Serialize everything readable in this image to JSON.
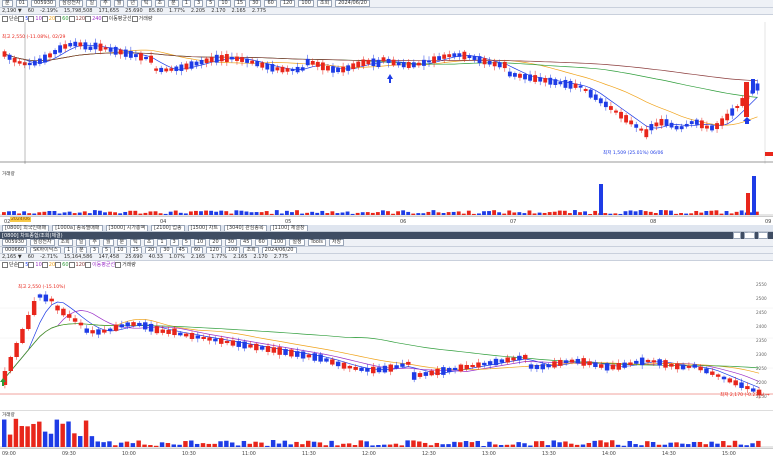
{
  "top": {
    "toolbar1_items": [
      "분",
      "01",
      "005930",
      "삼성전자",
      "일",
      "주",
      "월",
      "년",
      "틱",
      "초",
      "분",
      "1",
      "3",
      "5",
      "10",
      "15",
      "30",
      "60",
      "120",
      "100",
      "조회",
      "2024/06/20"
    ],
    "toolbar2_items": [
      "2,190 ▼",
      "60",
      "-2.19%",
      "15,798,508",
      "171,655",
      "25.690",
      "85.80",
      "1.77%",
      "2.205",
      "2.170",
      "2.165",
      "2.775"
    ],
    "legend_items": [
      "단순",
      "5",
      "10",
      "20",
      "60",
      "120",
      "240",
      "이동평균선",
      "거래량"
    ],
    "high_label": "최고 2,550 (-11.08%), 02/29",
    "low_label": "최저 1,509 (25.01%) 06/06",
    "volume_title": "거래량",
    "x_labels": [
      "02",
      "04",
      "05",
      "06",
      "07",
      "08",
      "09"
    ],
    "corner_label": "2024/06"
  },
  "mid": {
    "status_tabs": [
      "[0800] 외국인매매",
      "[1000a] 종목별매매",
      "[3000] 시가총액",
      "[2100] 업종",
      "[1500] 차트",
      "[3040] 관심종목",
      "[1100] 체결창"
    ],
    "title": "[0800] 차트종합/조회(체결)",
    "title_buttons": [
      "_",
      "□",
      "×"
    ],
    "row1": [
      "005930",
      "삼성전자",
      "조회",
      "일",
      "주",
      "월",
      "분",
      "틱",
      "초",
      "1",
      "3",
      "5",
      "10",
      "20",
      "30",
      "45",
      "60",
      "100",
      "설정",
      "Tools",
      "저장"
    ],
    "row2": [
      "000660",
      "SK하이닉스",
      "1",
      "분",
      "3",
      "5",
      "10",
      "15",
      "20",
      "30",
      "45",
      "60",
      "120",
      "100",
      "조회",
      "2024/06/20"
    ],
    "row3": [
      "2,165 ▼",
      "60",
      "-2.71%",
      "15,164,586",
      "147,458",
      "25.690",
      "40.33",
      "1.07%",
      "2.165",
      "1.77%",
      "2.165",
      "2.170",
      "2.775"
    ]
  },
  "bottom": {
    "legend_items": [
      "단순",
      "5",
      "10",
      "20",
      "60",
      "120",
      "이동평균선",
      "거래량"
    ],
    "high_label": "최고 2,550 (-15.10%)",
    "low_label": "최저 2,170 (-0.23%) →",
    "volume_title": "거래량",
    "x_labels": [
      "09:00",
      "09:30",
      "10:00",
      "10:30",
      "11:00",
      "11:30",
      "12:00",
      "12:30",
      "13:00",
      "13:30",
      "14:00",
      "14:30",
      "15:00"
    ],
    "price_scale": [
      "2550",
      "2500",
      "2450",
      "2400",
      "2350",
      "2300",
      "2250",
      "2200",
      "2150"
    ]
  },
  "colors": {
    "up": "#e8261b",
    "down": "#1e3ce6",
    "ma5": "#1e3ce6",
    "ma10": "#9b30c8",
    "ma20": "#f0a31b",
    "ma60": "#2e9d3a",
    "ma120": "#8a3a3a"
  }
}
